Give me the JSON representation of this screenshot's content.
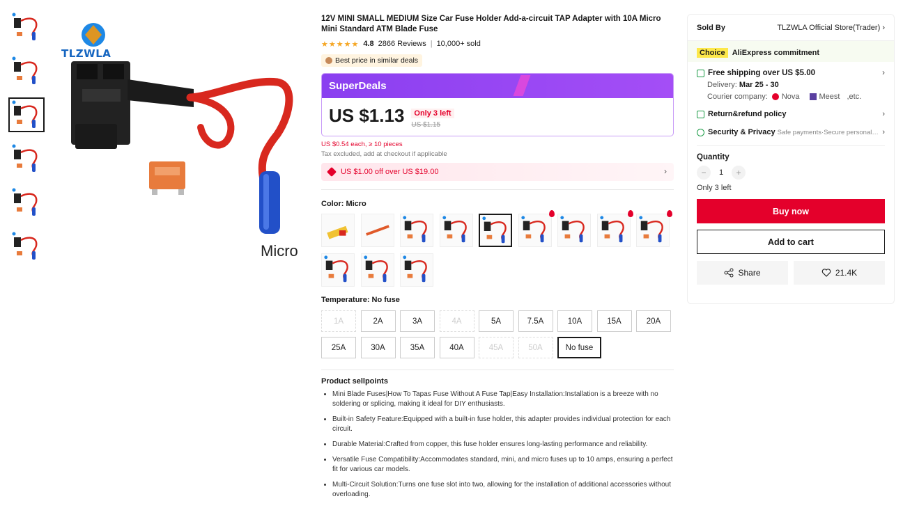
{
  "gallery": {
    "thumb_count": 6,
    "main_caption": "Micro",
    "brand": "TLZWLA"
  },
  "product": {
    "title": "12V MINI SMALL MEDIUM Size Car Fuse Holder Add-a-circuit TAP Adapter with 10A Micro Mini Standard ATM Blade Fuse",
    "rating": "4.8",
    "reviews": "2866 Reviews",
    "sold": "10,000+ sold",
    "best_price_badge": "Best price in similar deals"
  },
  "superdeals": {
    "label": "SuperDeals",
    "price": "US $1.13",
    "stock_badge": "Only 3 left",
    "old_price": "US $1.15",
    "bulk_price": "US $0.54 each, ≥ 10 pieces",
    "tax_note": "Tax excluded, add at checkout if applicable"
  },
  "coupon": {
    "text": "US $1.00 off over US $19.00"
  },
  "color": {
    "label": "Color: Micro",
    "selected_index": 4,
    "swatch_count": 12,
    "hot_indices": [
      5,
      7,
      8
    ]
  },
  "temperature": {
    "label": "Temperature: No fuse",
    "options": [
      {
        "label": "1A",
        "state": "disabled"
      },
      {
        "label": "2A",
        "state": "normal"
      },
      {
        "label": "3A",
        "state": "normal"
      },
      {
        "label": "4A",
        "state": "disabled"
      },
      {
        "label": "5A",
        "state": "normal"
      },
      {
        "label": "7.5A",
        "state": "normal"
      },
      {
        "label": "10A",
        "state": "normal"
      },
      {
        "label": "15A",
        "state": "normal"
      },
      {
        "label": "20A",
        "state": "normal"
      },
      {
        "label": "25A",
        "state": "normal"
      },
      {
        "label": "30A",
        "state": "normal"
      },
      {
        "label": "35A",
        "state": "normal"
      },
      {
        "label": "40A",
        "state": "normal"
      },
      {
        "label": "45A",
        "state": "disabled"
      },
      {
        "label": "50A",
        "state": "disabled"
      },
      {
        "label": "No fuse",
        "state": "selected"
      }
    ]
  },
  "sellpoints": {
    "title": "Product sellpoints",
    "items": [
      "Mini Blade Fuses|How To Tapas Fuse Without A Fuse Tap|Easy Installation:Installation is a breeze with no soldering or splicing, making it ideal for DIY enthusiasts.",
      "Built-in Safety Feature:Equipped with a built-in fuse holder, this adapter provides individual protection for each circuit.",
      "Durable Material:Crafted from copper, this fuse holder ensures long-lasting performance and reliability.",
      "Versatile Fuse Compatibility:Accommodates standard, mini, and micro fuses up to 10 amps, ensuring a perfect fit for various car models.",
      "Multi-Circuit Solution:Turns one fuse slot into two, allowing for the installation of additional accessories without overloading."
    ]
  },
  "side": {
    "sold_by_label": "Sold By",
    "store_name": "TLZWLA Official Store(Trader)",
    "choice_badge": "Choice",
    "commitment": "AliExpress commitment",
    "shipping": "Free shipping over US $5.00",
    "delivery_label": "Delivery:",
    "delivery_dates": "Mar 25 - 30",
    "courier_label": "Courier company:",
    "courier_1": "Nova",
    "courier_2": "Meest",
    "courier_etc": ",etc.",
    "return_policy": "Return&refund policy",
    "security": "Security & Privacy",
    "security_detail": "Safe payments·Secure personal details",
    "quantity_label": "Quantity",
    "quantity_value": "1",
    "stock_note": "Only 3 left",
    "buy_now": "Buy now",
    "add_to_cart": "Add to cart",
    "share": "Share",
    "wishlist_count": "21.4K"
  },
  "colors": {
    "accent_red": "#e4002b",
    "superdeals_purple": "#8a3ff0",
    "choice_yellow": "#fde84a",
    "star": "#f5a623",
    "wire_red": "#d8281e",
    "connector_blue": "#2250c8"
  }
}
